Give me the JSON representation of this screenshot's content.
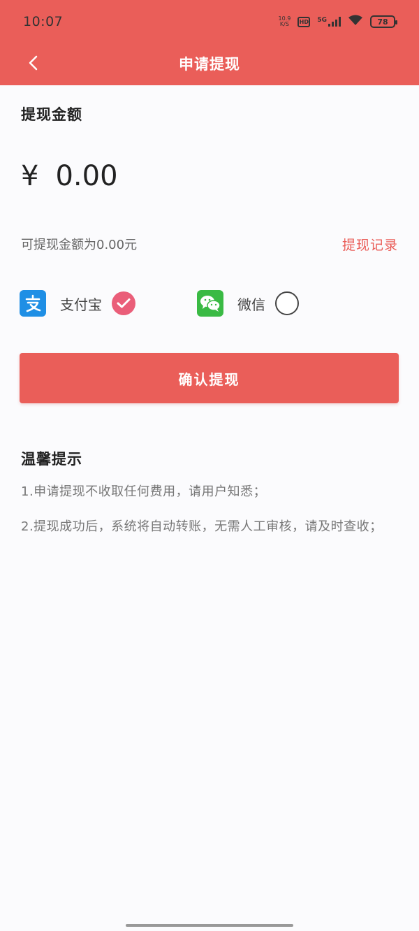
{
  "status_bar": {
    "time": "10:07",
    "signal_small_top": "10.9",
    "signal_small_bottom": "K/S",
    "sim_label": "HD",
    "network": "5G",
    "battery": "78"
  },
  "nav": {
    "back_icon": "chevron-left-icon",
    "title": "申请提现"
  },
  "amount": {
    "label": "提现金额",
    "currency_symbol": "¥",
    "value": "0.00"
  },
  "balance": {
    "available_text": "可提现金额为0.00元",
    "record_link": "提现记录"
  },
  "payment_methods": [
    {
      "name": "支付宝",
      "icon": "alipay-icon",
      "selected": true
    },
    {
      "name": "微信",
      "icon": "wechat-icon",
      "selected": false
    }
  ],
  "confirm_button": "确认提现",
  "tips": {
    "title": "温馨提示",
    "items": [
      "1.申请提现不收取任何费用，请用户知悉；",
      "2.提现成功后，系统将自动转账，无需人工审核，请及时查收；"
    ]
  },
  "colors": {
    "primary": "#ea5e59",
    "check": "#ea5e79",
    "alipay": "#1f8fe5",
    "wechat": "#3aba44"
  }
}
